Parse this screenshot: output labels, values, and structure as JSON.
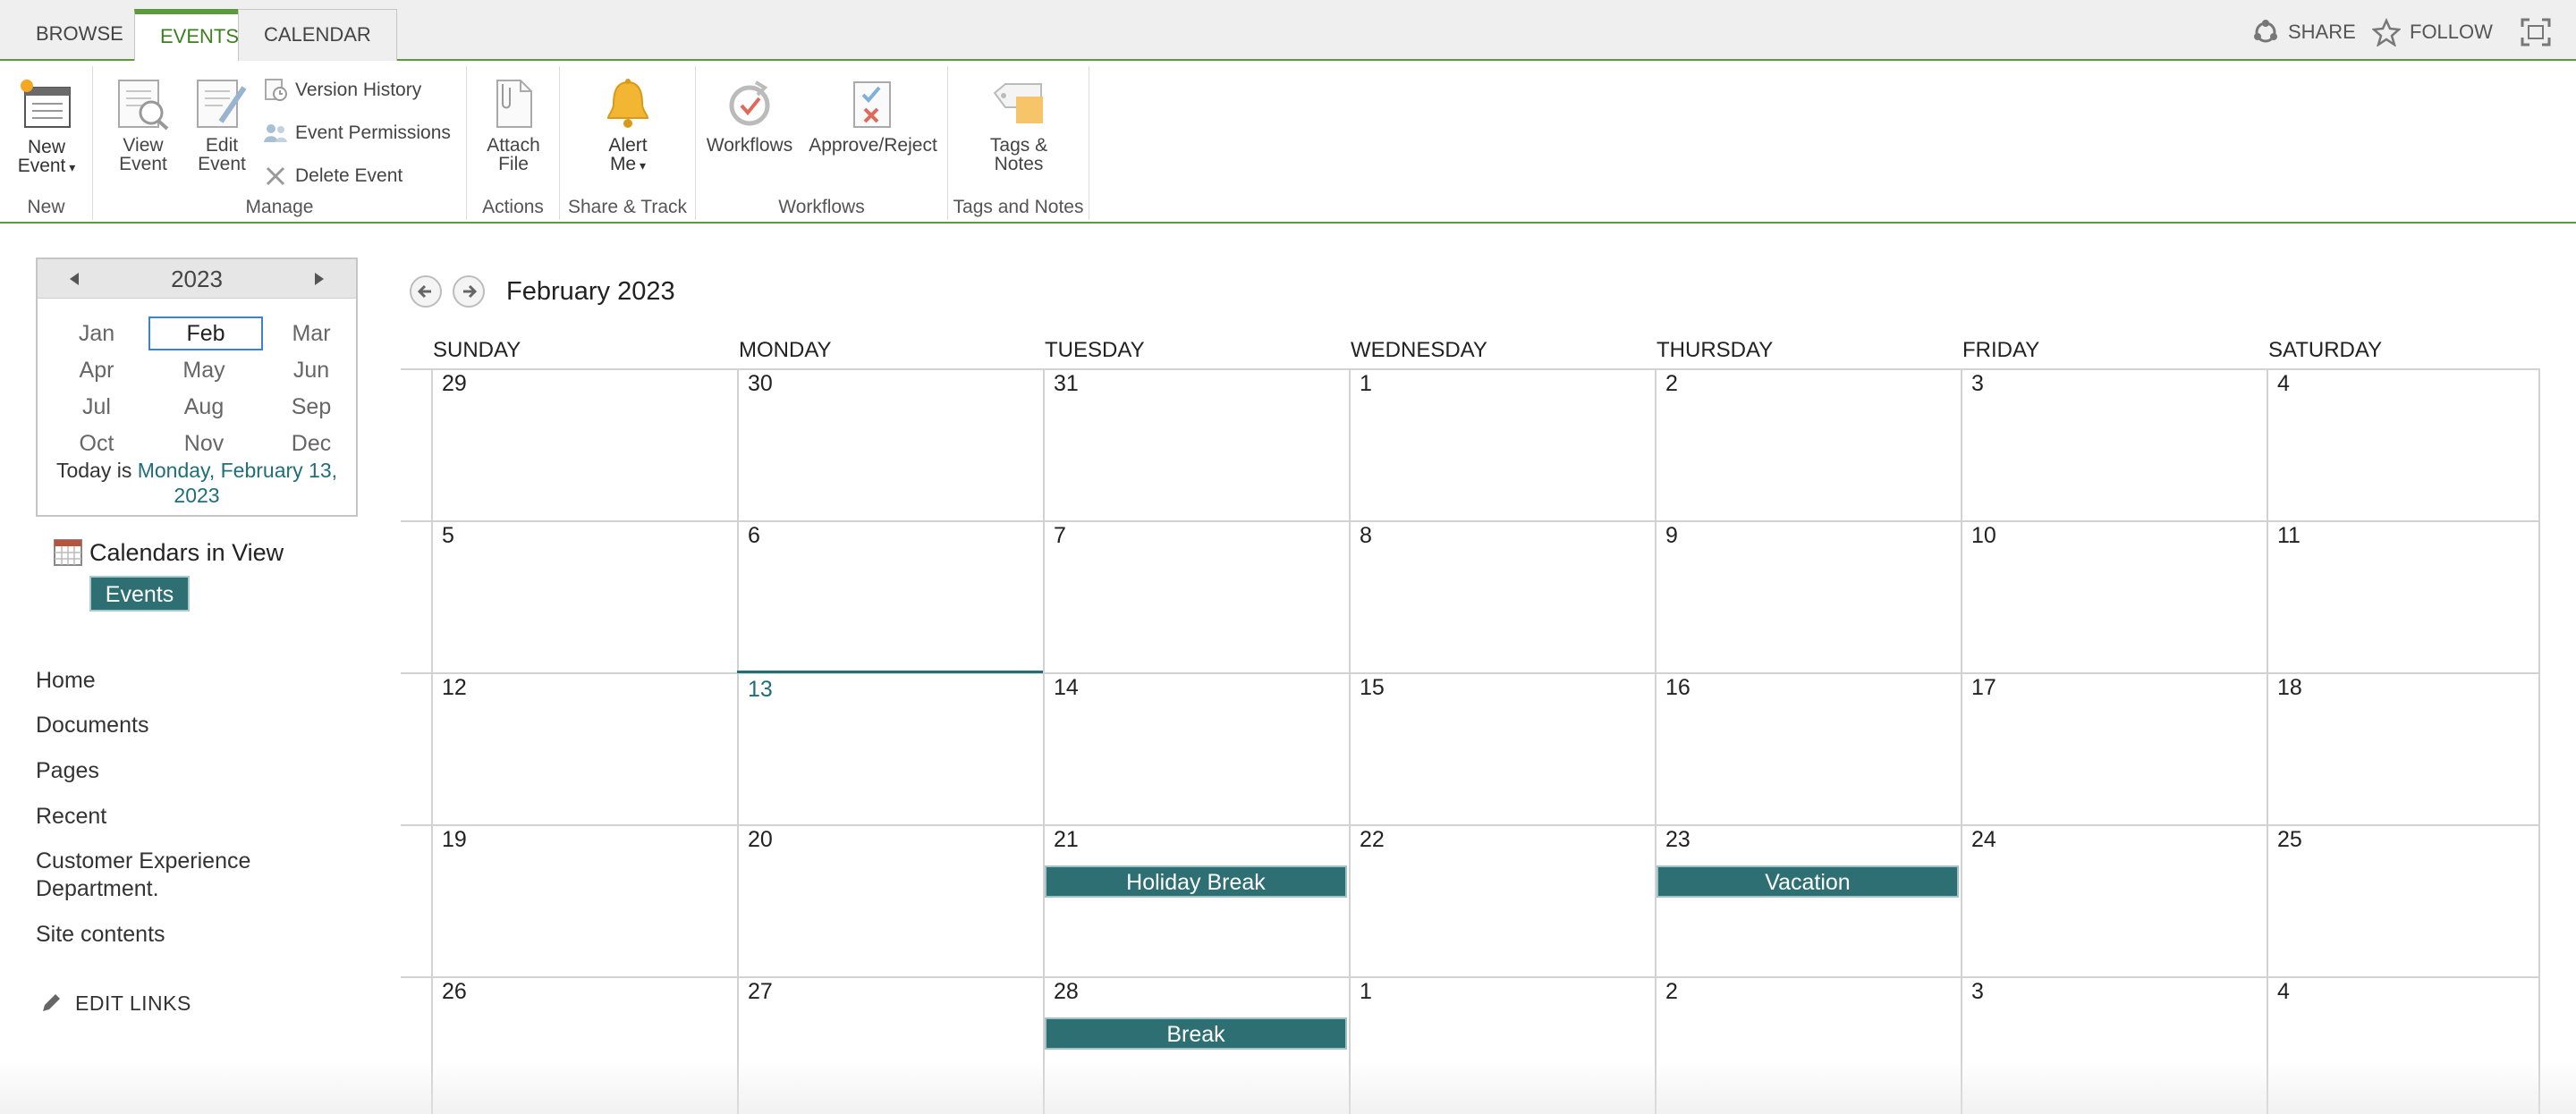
{
  "ribbon_tabs": [
    "BROWSE",
    "EVENTS",
    "CALENDAR"
  ],
  "top_actions": {
    "share": "SHARE",
    "follow": "FOLLOW"
  },
  "ribbon": {
    "new_event": [
      "New",
      "Event"
    ],
    "view_event": [
      "View",
      "Event"
    ],
    "edit_event": [
      "Edit",
      "Event"
    ],
    "version_history": "Version History",
    "event_permissions": "Event Permissions",
    "delete_event": "Delete Event",
    "attach_file": [
      "Attach",
      "File"
    ],
    "alert_me": [
      "Alert",
      "Me"
    ],
    "workflows": "Workflows",
    "approve_reject": "Approve/Reject",
    "tags_notes": [
      "Tags &",
      "Notes"
    ],
    "groups": {
      "new": "New",
      "manage": "Manage",
      "actions": "Actions",
      "share_track": "Share & Track",
      "workflows": "Workflows",
      "tags_notes": "Tags and Notes"
    }
  },
  "date_picker": {
    "year": "2023",
    "months": [
      "Jan",
      "Feb",
      "Mar",
      "Apr",
      "May",
      "Jun",
      "Jul",
      "Aug",
      "Sep",
      "Oct",
      "Nov",
      "Dec"
    ],
    "selected_month": "Feb",
    "today_prefix": "Today is ",
    "today_date": "Monday, February 13, 2023"
  },
  "calendars_in_view": {
    "label": "Calendars in View",
    "chip": "Events"
  },
  "nav": [
    "Home",
    "Documents",
    "Pages",
    "Recent",
    "Customer Experience Department.",
    "Site contents"
  ],
  "edit_links": "EDIT LINKS",
  "calendar": {
    "title": "February 2023",
    "day_headers": [
      "SUNDAY",
      "MONDAY",
      "TUESDAY",
      "WEDNESDAY",
      "THURSDAY",
      "FRIDAY",
      "SATURDAY"
    ],
    "weeks": [
      [
        "29",
        "30",
        "31",
        "1",
        "2",
        "3",
        "4"
      ],
      [
        "5",
        "6",
        "7",
        "8",
        "9",
        "10",
        "11"
      ],
      [
        "12",
        "13",
        "14",
        "15",
        "16",
        "17",
        "18"
      ],
      [
        "19",
        "20",
        "21",
        "22",
        "23",
        "24",
        "25"
      ],
      [
        "26",
        "27",
        "28",
        "1",
        "2",
        "3",
        "4"
      ]
    ],
    "today": "13",
    "events": [
      {
        "title": "Holiday Break",
        "week": 3,
        "day": 2
      },
      {
        "title": "Vacation",
        "week": 3,
        "day": 4
      },
      {
        "title": "Break",
        "week": 4,
        "day": 2
      }
    ]
  },
  "colors": {
    "accent": "#5d9a3e",
    "event": "#2e6f74",
    "today": "#1f6e7a",
    "selection": "#3a82d9"
  }
}
